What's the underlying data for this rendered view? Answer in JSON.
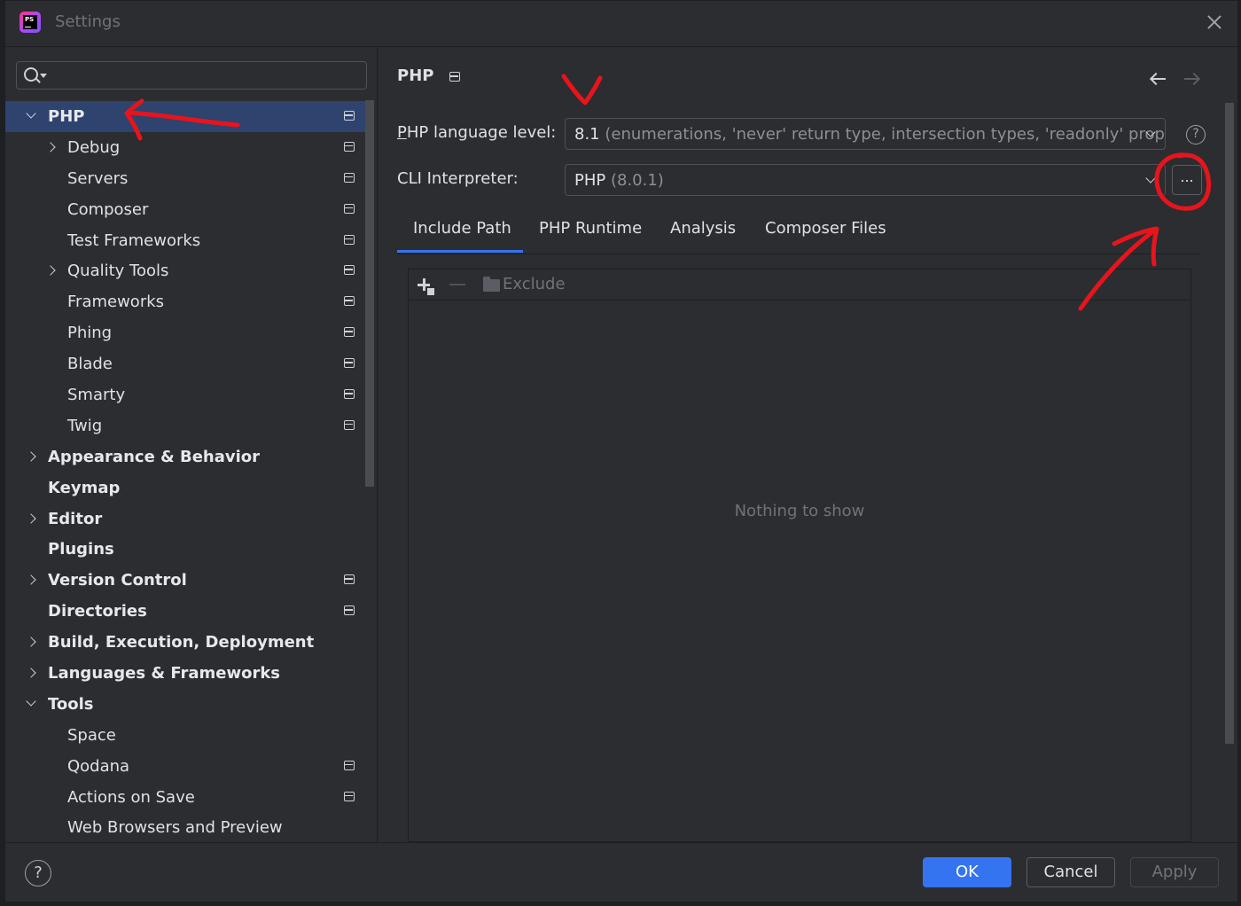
{
  "window": {
    "title": "Settings",
    "app_icon_letters": "PS"
  },
  "search": {
    "value": "",
    "placeholder": ""
  },
  "tree": {
    "items": [
      {
        "label": "PHP",
        "level": 0,
        "expanded": true,
        "selected": true,
        "project_icon": true
      },
      {
        "label": "Debug",
        "level": 1,
        "chevron": "right",
        "project_icon": true
      },
      {
        "label": "Servers",
        "level": 1,
        "project_icon": true
      },
      {
        "label": "Composer",
        "level": 1,
        "project_icon": true
      },
      {
        "label": "Test Frameworks",
        "level": 1,
        "project_icon": true
      },
      {
        "label": "Quality Tools",
        "level": 1,
        "chevron": "right",
        "project_icon": true
      },
      {
        "label": "Frameworks",
        "level": 1,
        "project_icon": true
      },
      {
        "label": "Phing",
        "level": 1,
        "project_icon": true
      },
      {
        "label": "Blade",
        "level": 1,
        "project_icon": true
      },
      {
        "label": "Smarty",
        "level": 1,
        "project_icon": true
      },
      {
        "label": "Twig",
        "level": 1,
        "project_icon": true
      },
      {
        "label": "Appearance & Behavior",
        "level": 0,
        "chevron": "right"
      },
      {
        "label": "Keymap",
        "level": 0
      },
      {
        "label": "Editor",
        "level": 0,
        "chevron": "right"
      },
      {
        "label": "Plugins",
        "level": 0
      },
      {
        "label": "Version Control",
        "level": 0,
        "chevron": "right",
        "project_icon": true
      },
      {
        "label": "Directories",
        "level": 0,
        "project_icon": true
      },
      {
        "label": "Build, Execution, Deployment",
        "level": 0,
        "chevron": "right"
      },
      {
        "label": "Languages & Frameworks",
        "level": 0,
        "chevron": "right"
      },
      {
        "label": "Tools",
        "level": 0,
        "chevron": "down"
      },
      {
        "label": "Space",
        "level": 1
      },
      {
        "label": "Qodana",
        "level": 1,
        "project_icon": true
      },
      {
        "label": "Actions on Save",
        "level": 1,
        "project_icon": true
      },
      {
        "label": "Web Browsers and Preview",
        "level": 1
      }
    ]
  },
  "page": {
    "title": "PHP",
    "language_level": {
      "label_first": "P",
      "label_rest": "HP language level:",
      "value": "8.1",
      "hint": "(enumerations, 'never' return type, intersection types, 'readonly' proper"
    },
    "cli": {
      "label": "CLI Interpreter:",
      "value": "PHP",
      "hint": "(8.0.1)",
      "browse_label": "..."
    },
    "tabs": [
      "Include Path",
      "PHP Runtime",
      "Analysis",
      "Composer Files"
    ],
    "list": {
      "exclude_label": "Exclude",
      "empty_text": "Nothing to show"
    }
  },
  "footer": {
    "help": "?",
    "ok": "OK",
    "cancel": "Cancel",
    "apply": "Apply"
  },
  "colors": {
    "background": "#2b2d30",
    "selection": "#2e436e",
    "accent": "#3574f0",
    "annotation": "#e8141c"
  }
}
